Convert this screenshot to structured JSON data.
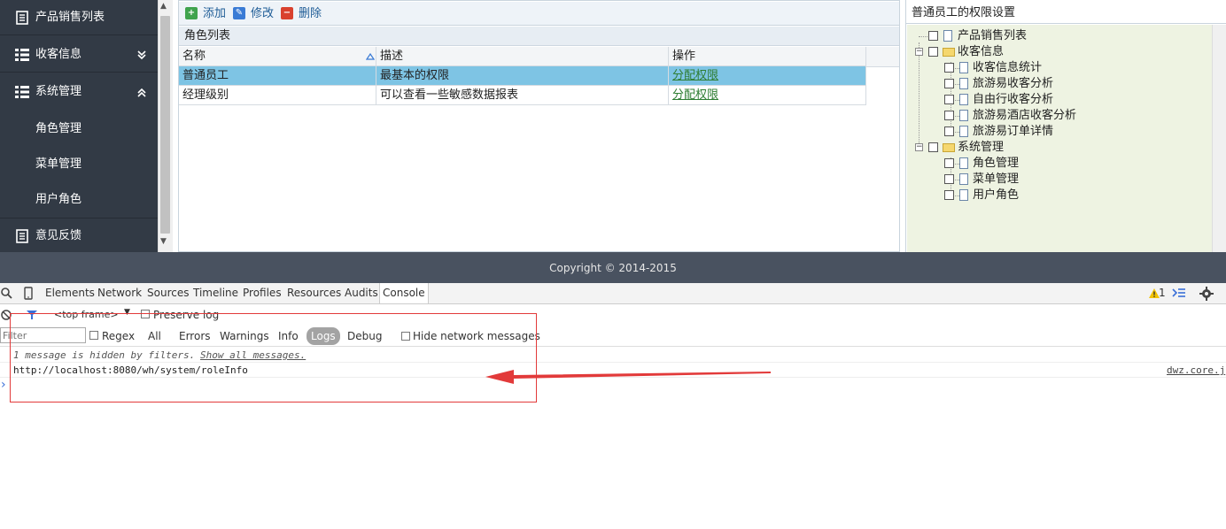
{
  "sidebar": {
    "top_items": [
      {
        "label": "产品销售列表"
      },
      {
        "label": "收客信息",
        "chevron": "double-down"
      },
      {
        "label": "系统管理",
        "chevron": "double-up"
      }
    ],
    "sub_items": [
      {
        "label": "角色管理"
      },
      {
        "label": "菜单管理"
      },
      {
        "label": "用户角色"
      }
    ],
    "bottom_item": {
      "label": "意见反馈"
    }
  },
  "toolbar": {
    "add_label": "添加",
    "edit_label": "修改",
    "delete_label": "删除"
  },
  "grid": {
    "title": "角色列表",
    "columns": [
      "名称",
      "描述",
      "操作"
    ],
    "rows": [
      {
        "name": "普通员工",
        "desc": "最基本的权限",
        "action": "分配权限",
        "selected": true
      },
      {
        "name": "经理级别",
        "desc": "可以查看一些敏感数据报表",
        "action": "分配权限",
        "selected": false
      }
    ]
  },
  "permissions": {
    "title": "普通员工的权限设置",
    "tree": [
      {
        "label": "产品销售列表"
      },
      {
        "label": "收客信息",
        "children": [
          "收客信息统计",
          "旅游易收客分析",
          "自由行收客分析",
          "旅游易酒店收客分析",
          "旅游易订单详情"
        ]
      },
      {
        "label": "系统管理",
        "children": [
          "角色管理",
          "菜单管理",
          "用户角色"
        ]
      }
    ]
  },
  "footer": {
    "text": "Copyright © 2014-2015"
  },
  "devtools": {
    "tabs": [
      "Elements",
      "Network",
      "Sources",
      "Timeline",
      "Profiles",
      "Resources",
      "Audits",
      "Console"
    ],
    "active_tab": "Console",
    "warning_count": "1",
    "frame_select": "<top frame>",
    "preserve_log": "Preserve log",
    "filter_placeholder": "Filter",
    "regex": "Regex",
    "levels": [
      "All",
      "Errors",
      "Warnings",
      "Info",
      "Logs",
      "Debug"
    ],
    "active_level": "Logs",
    "hide_network": "Hide network messages",
    "hidden_msg": "1 message is hidden by filters.",
    "show_all": "Show all messages.",
    "log_url": "http://localhost:8080/wh/system/roleInfo",
    "log_source": "dwz.core.j",
    "prompt": "›"
  },
  "colors": {
    "sidebar_bg": "#323a45",
    "footer_bg": "#495260",
    "selected_row": "#7ec4e4",
    "tree_bg": "#eef3e2",
    "annotation_red": "#e23a3a"
  }
}
